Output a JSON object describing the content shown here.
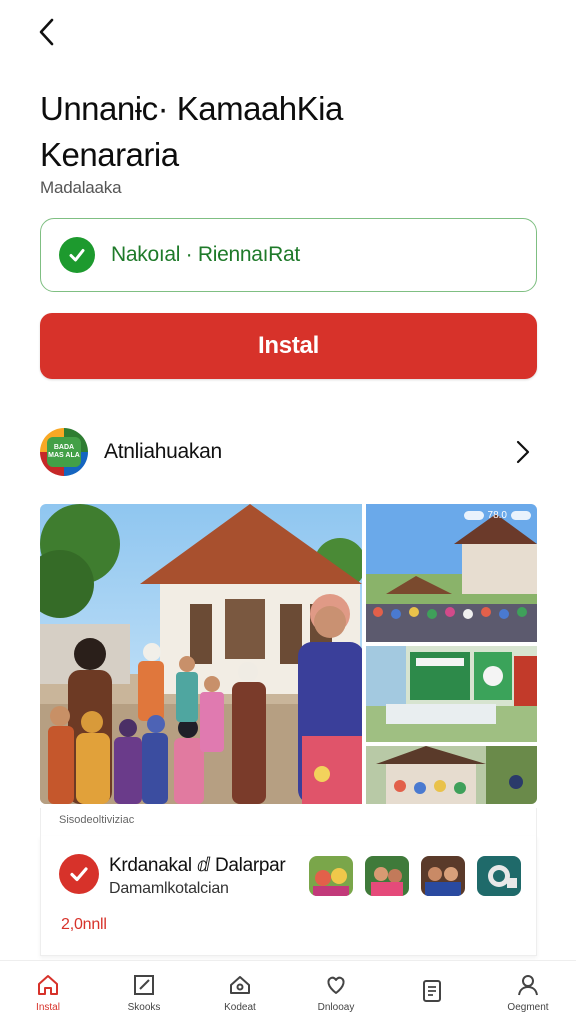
{
  "app": {
    "title_line1": "Unnanɨc· KamaahKia",
    "title_line2": "Kenararia",
    "developer_sub": "Madalaaka"
  },
  "verified": {
    "text": "Nakoıal · RiennaıRat",
    "accent": "#1d9a2e"
  },
  "install": {
    "label": "Instal",
    "color": "#d7322a"
  },
  "developer_row": {
    "logo_text": "BADA MAS ALA",
    "name": "Atnliahuakan"
  },
  "gallery": {
    "status_time": "78.0",
    "caption": "Sisodeoltiviziac"
  },
  "promo": {
    "title": "Krdanakal ⅆ Dalarpar",
    "subtitle": "Damamlkotalcian",
    "price": "2,0nnll"
  },
  "bottom_nav": {
    "items": [
      {
        "label": "Instal",
        "icon": "home-icon",
        "active": true
      },
      {
        "label": "Skooks",
        "icon": "edit-icon",
        "active": false
      },
      {
        "label": "Kodeat",
        "icon": "home-outline-icon",
        "active": false
      },
      {
        "label": "Dnlooay",
        "icon": "heart-icon",
        "active": false
      },
      {
        "label": "",
        "icon": "book-icon",
        "active": false
      },
      {
        "label": "Oegment",
        "icon": "user-icon",
        "active": false
      }
    ]
  }
}
